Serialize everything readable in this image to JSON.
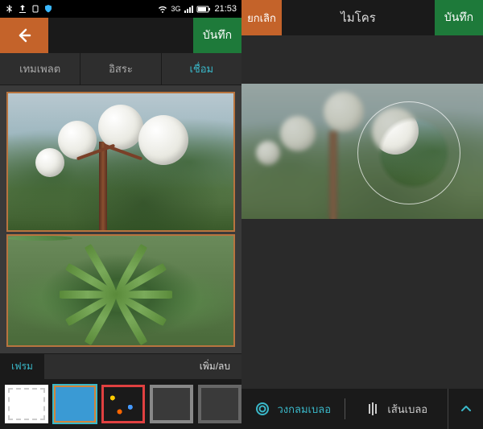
{
  "status": {
    "time": "21:53",
    "net": "3G"
  },
  "left": {
    "save": "บันทึก",
    "tabs": {
      "template": "เทมเพลต",
      "free": "อิสระ",
      "connect": "เชื่อม"
    },
    "bottom": {
      "frame": "เฟรม",
      "addremove": "เพิ่ม/ลบ"
    }
  },
  "right": {
    "cancel": "ยกเลิก",
    "title": "ไมโคร",
    "save": "บันทึก",
    "blur": {
      "circle": "วงกลมเบลอ",
      "line": "เส้นเบลอ"
    }
  }
}
